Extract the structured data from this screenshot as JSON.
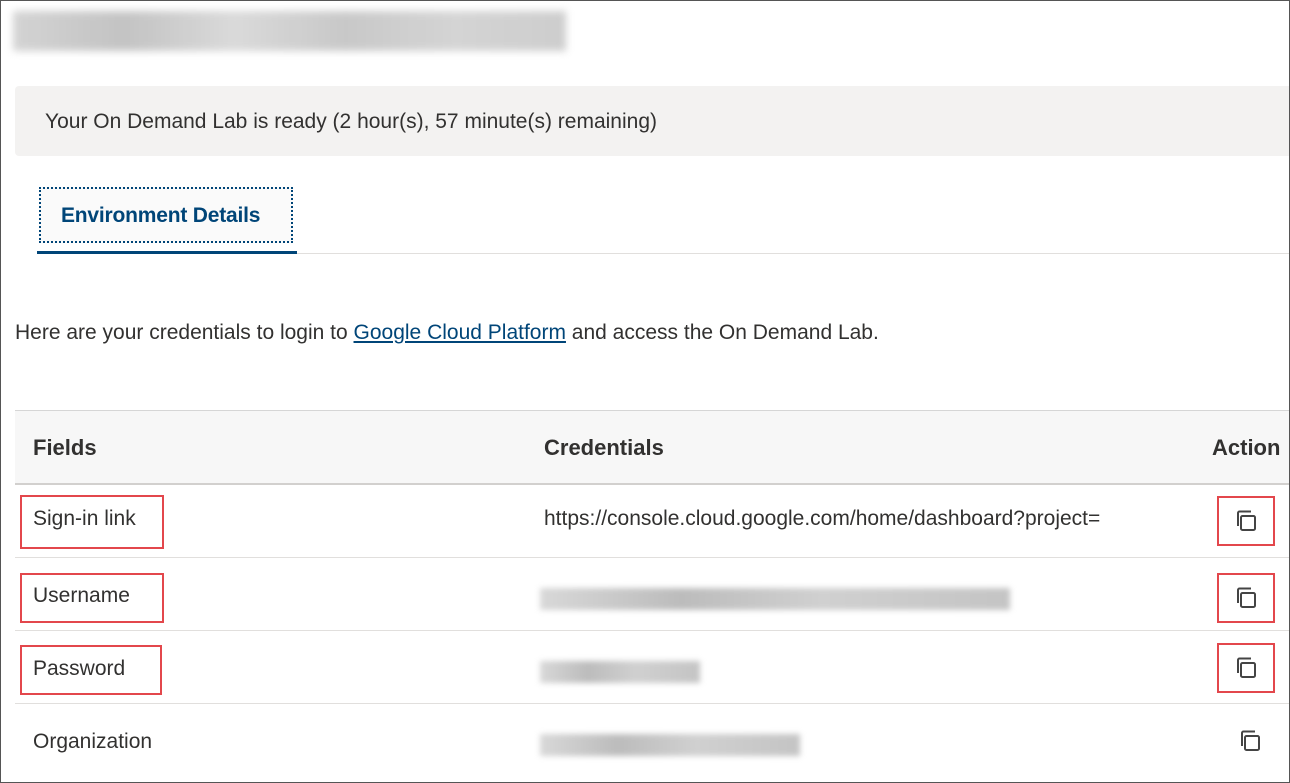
{
  "status": {
    "text": "Your On Demand Lab is ready (2 hour(s), 57 minute(s) remaining)"
  },
  "tabs": [
    {
      "label": "Environment Details"
    }
  ],
  "intro": {
    "before": "Here are your credentials to login to ",
    "link_text": "Google Cloud Platform",
    "after": " and access the On Demand Lab."
  },
  "table": {
    "headers": {
      "fields": "Fields",
      "credentials": "Credentials",
      "action": "Action"
    },
    "rows": [
      {
        "field": "Sign-in link",
        "credential": "https://console.cloud.google.com/home/dashboard?project=",
        "credential_visible": true,
        "action_icon": "copy-icon"
      },
      {
        "field": "Username",
        "credential": "",
        "credential_visible": false,
        "action_icon": "copy-icon"
      },
      {
        "field": "Password",
        "credential": "",
        "credential_visible": false,
        "action_icon": "copy-icon"
      },
      {
        "field": "Organization",
        "credential": "",
        "credential_visible": false,
        "action_icon": "copy-icon"
      }
    ]
  },
  "colors": {
    "accent": "#004578",
    "highlight": "#e3474c",
    "banner_bg": "#f3f2f1"
  }
}
